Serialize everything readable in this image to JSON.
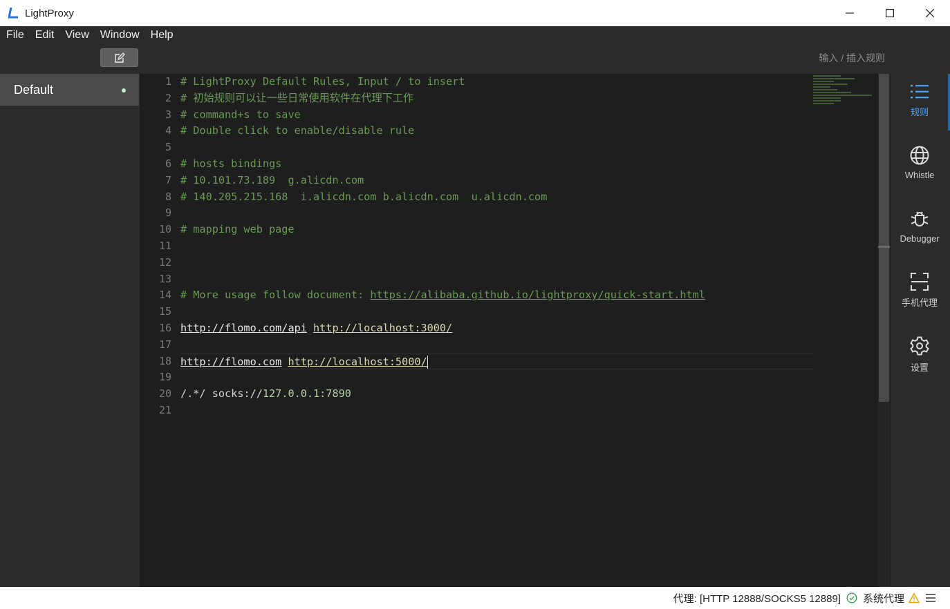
{
  "window": {
    "title": "LightProxy",
    "controls": [
      "minimize-icon",
      "maximize-icon",
      "close-icon"
    ]
  },
  "menu": {
    "items": [
      "File",
      "Edit",
      "View",
      "Window",
      "Help"
    ]
  },
  "sidebar": {
    "edit_icon": "edit-icon",
    "rules": [
      {
        "label": "Default",
        "enabled": true
      }
    ]
  },
  "editor": {
    "hint": "输入 / 插入规则",
    "line_numbers": [
      "1",
      "2",
      "3",
      "4",
      "5",
      "6",
      "7",
      "8",
      "9",
      "10",
      "11",
      "12",
      "13",
      "14",
      "15",
      "16",
      "17",
      "18",
      "19",
      "20",
      "21"
    ],
    "lines": {
      "l1": "# LightProxy Default Rules, Input / to insert",
      "l2": "# 初始规则可以让一些日常使用软件在代理下工作",
      "l3": "# command+s to save",
      "l4": "# Double click to enable/disable rule",
      "l6": "# hosts bindings",
      "l7": "# 10.101.73.189  g.alicdn.com",
      "l8": "# 140.205.215.168  i.alicdn.com b.alicdn.com  u.alicdn.com",
      "l10": "# mapping web page",
      "l14_prefix": "# More usage follow document: ",
      "l14_link": "https://alibaba.github.io/lightproxy/quick-start.html",
      "l16_a": "http://flomo.com/api",
      "l16_b": "http://localhost:3000/",
      "l18_a": "http://flomo.com",
      "l18_b": "http://localhost:5000/",
      "l20_a": "/.*/ socks://",
      "l20_b": "127.0.0.1:7890"
    },
    "current_line": 18
  },
  "right_nav": [
    {
      "label": "规则",
      "icon": "list-icon",
      "active": true
    },
    {
      "label": "Whistle",
      "icon": "globe-icon",
      "active": false
    },
    {
      "label": "Debugger",
      "icon": "bug-icon",
      "active": false
    },
    {
      "label": "手机代理",
      "icon": "scan-icon",
      "active": false
    },
    {
      "label": "设置",
      "icon": "gear-icon",
      "active": false
    }
  ],
  "status": {
    "proxy_text": "代理: [HTTP 12888/SOCKS5 12889]",
    "proxy_ok_icon": "check-circle-icon",
    "system_proxy_label": "系统代理",
    "system_proxy_icon": "warning-icon",
    "menu_icon": "hamburger-icon"
  },
  "colors": {
    "accent": "#4ea6ff",
    "comment": "#6a9955",
    "ok": "#2ea043",
    "warn": "#f2b600"
  }
}
